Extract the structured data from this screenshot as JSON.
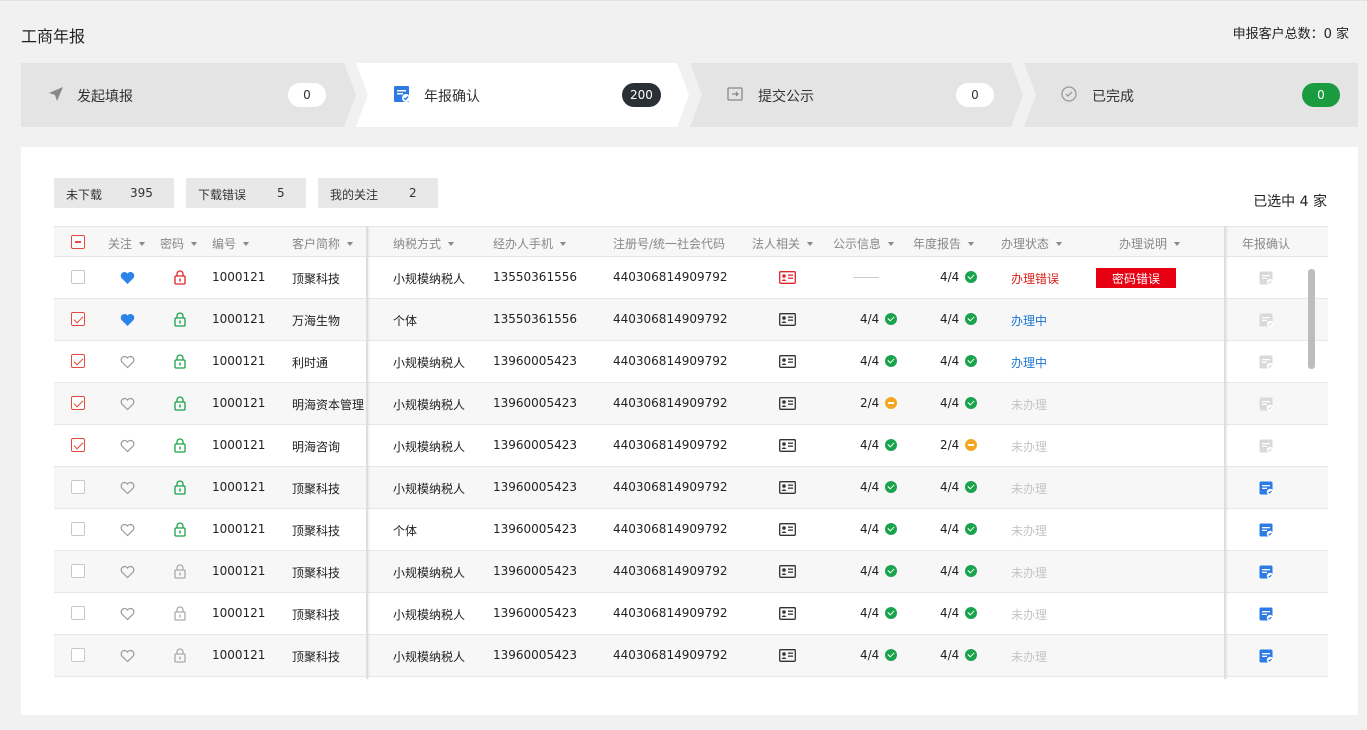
{
  "header": {
    "title": "工商年报",
    "total_label": "申报客户总数：0 家"
  },
  "steps": [
    {
      "label": "发起填报",
      "count": "0",
      "icon": "send-arrow-icon"
    },
    {
      "label": "年报确认",
      "count": "200",
      "icon": "report-confirm-icon"
    },
    {
      "label": "提交公示",
      "count": "0",
      "icon": "submit-export-icon"
    },
    {
      "label": "已完成",
      "count": "0",
      "icon": "check-circle-icon"
    }
  ],
  "filters": [
    {
      "label": "未下载",
      "count": "395"
    },
    {
      "label": "下载错误",
      "count": "5"
    },
    {
      "label": "我的关注",
      "count": "2"
    }
  ],
  "selected_label": "已选中 4 家",
  "columns": {
    "follow": "关注",
    "password": "密码",
    "id": "编号",
    "name": "客户简称",
    "tax": "纳税方式",
    "phone": "经办人手机",
    "reg": "注册号/统一社会代码",
    "legal": "法人相关",
    "public": "公示信息",
    "annual": "年度报告",
    "status": "办理状态",
    "note": "办理说明",
    "confirm": "年报确认"
  },
  "rows": [
    {
      "checked": false,
      "fav": true,
      "lock": "red",
      "id": "1000121",
      "name": "顶聚科技",
      "tax": "小规模纳税人",
      "phone": "13550361556",
      "reg": "440306814909792",
      "legal_card": "red",
      "public": "",
      "public_icon": "none",
      "annual": "4/4",
      "annual_icon": "ok",
      "status": "办理错误",
      "status_type": "err",
      "note": "密码错误",
      "confirm_icon": "gray"
    },
    {
      "checked": true,
      "fav": true,
      "lock": "green",
      "id": "1000121",
      "name": "万海生物",
      "tax": "个体",
      "phone": "13550361556",
      "reg": "440306814909792",
      "legal_card": "dark",
      "public": "4/4",
      "public_icon": "ok",
      "annual": "4/4",
      "annual_icon": "ok",
      "status": "办理中",
      "status_type": "doing",
      "note": "",
      "confirm_icon": "gray"
    },
    {
      "checked": true,
      "fav": false,
      "lock": "green",
      "id": "1000121",
      "name": "利时通",
      "tax": "小规模纳税人",
      "phone": "13960005423",
      "reg": "440306814909792",
      "legal_card": "dark",
      "public": "4/4",
      "public_icon": "ok",
      "annual": "4/4",
      "annual_icon": "ok",
      "status": "办理中",
      "status_type": "doing",
      "note": "",
      "confirm_icon": "gray"
    },
    {
      "checked": true,
      "fav": false,
      "lock": "green",
      "id": "1000121",
      "name": "明海资本管理",
      "tax": "小规模纳税人",
      "phone": "13960005423",
      "reg": "440306814909792",
      "legal_card": "dark",
      "public": "2/4",
      "public_icon": "warn",
      "annual": "4/4",
      "annual_icon": "ok",
      "status": "未办理",
      "status_type": "none",
      "note": "",
      "confirm_icon": "gray"
    },
    {
      "checked": true,
      "fav": false,
      "lock": "green",
      "id": "1000121",
      "name": "明海咨询",
      "tax": "小规模纳税人",
      "phone": "13960005423",
      "reg": "440306814909792",
      "legal_card": "dark",
      "public": "4/4",
      "public_icon": "ok",
      "annual": "2/4",
      "annual_icon": "warn",
      "status": "未办理",
      "status_type": "none",
      "note": "",
      "confirm_icon": "gray"
    },
    {
      "checked": false,
      "fav": false,
      "lock": "green",
      "id": "1000121",
      "name": "顶聚科技",
      "tax": "小规模纳税人",
      "phone": "13960005423",
      "reg": "440306814909792",
      "legal_card": "dark",
      "public": "4/4",
      "public_icon": "ok",
      "annual": "4/4",
      "annual_icon": "ok",
      "status": "未办理",
      "status_type": "none",
      "note": "",
      "confirm_icon": "blue"
    },
    {
      "checked": false,
      "fav": false,
      "lock": "green",
      "id": "1000121",
      "name": "顶聚科技",
      "tax": "个体",
      "phone": "13960005423",
      "reg": "440306814909792",
      "legal_card": "dark",
      "public": "4/4",
      "public_icon": "ok",
      "annual": "4/4",
      "annual_icon": "ok",
      "status": "未办理",
      "status_type": "none",
      "note": "",
      "confirm_icon": "blue"
    },
    {
      "checked": false,
      "fav": false,
      "lock": "gray",
      "id": "1000121",
      "name": "顶聚科技",
      "tax": "小规模纳税人",
      "phone": "13960005423",
      "reg": "440306814909792",
      "legal_card": "dark",
      "public": "4/4",
      "public_icon": "ok",
      "annual": "4/4",
      "annual_icon": "ok",
      "status": "未办理",
      "status_type": "none",
      "note": "",
      "confirm_icon": "blue"
    },
    {
      "checked": false,
      "fav": false,
      "lock": "gray",
      "id": "1000121",
      "name": "顶聚科技",
      "tax": "小规模纳税人",
      "phone": "13960005423",
      "reg": "440306814909792",
      "legal_card": "dark",
      "public": "4/4",
      "public_icon": "ok",
      "annual": "4/4",
      "annual_icon": "ok",
      "status": "未办理",
      "status_type": "none",
      "note": "",
      "confirm_icon": "blue"
    },
    {
      "checked": false,
      "fav": false,
      "lock": "gray",
      "id": "1000121",
      "name": "顶聚科技",
      "tax": "小规模纳税人",
      "phone": "13960005423",
      "reg": "440306814909792",
      "legal_card": "dark",
      "public": "4/4",
      "public_icon": "ok",
      "annual": "4/4",
      "annual_icon": "ok",
      "status": "未办理",
      "status_type": "none",
      "note": "",
      "confirm_icon": "blue"
    }
  ],
  "colors": {
    "accent_red": "#e54a3d",
    "badge_red": "#e60012",
    "ok_green": "#1aa34a",
    "warn_orange": "#f5a623",
    "doing_blue": "#1a76d2",
    "count_dark": "#2b2f36",
    "count_green": "#1a9b3f"
  }
}
